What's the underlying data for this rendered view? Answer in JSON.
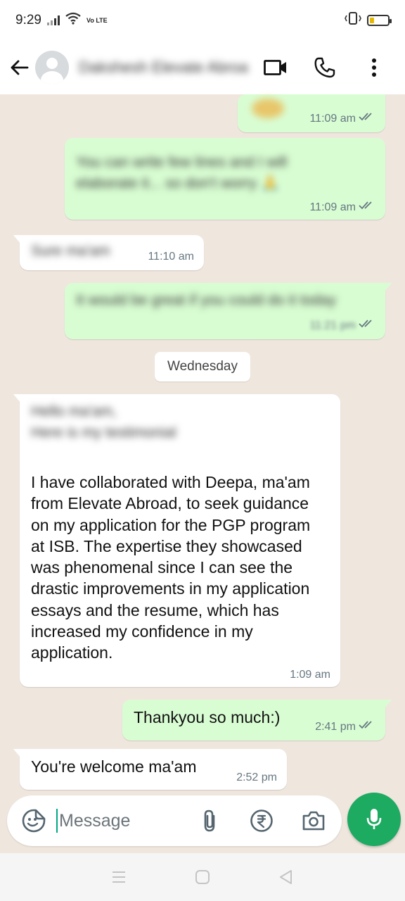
{
  "status_bar": {
    "time": "9:29",
    "network_label": "Vo LTE"
  },
  "header": {
    "contact_name": "Dakshesh Elevate Abroad",
    "icons": [
      "back-arrow-icon",
      "avatar",
      "video-call-icon",
      "voice-call-icon",
      "more-options-icon"
    ]
  },
  "messages": [
    {
      "direction": "outgoing",
      "text": "",
      "time": "11:09 am",
      "read": true,
      "blurred": true
    },
    {
      "direction": "outgoing",
      "text": "You can write few lines and I will elaborate it... so don't worry 🙏",
      "time": "11:09 am",
      "read": true,
      "blurred": true
    },
    {
      "direction": "incoming",
      "text": "Sure ma'am",
      "time": "11:10 am",
      "blurred": true
    },
    {
      "direction": "outgoing",
      "text": "It would be great if you could do it today",
      "time": "11:21 pm",
      "read": true,
      "blurred": true
    },
    {
      "direction": "incoming",
      "intro": "Hello ma'am,\nHere is my testimonial",
      "text": "I have collaborated with Deepa, ma'am from Elevate Abroad, to seek guidance on my application for the PGP program at ISB. The expertise they showcased was phenomenal since I can see the drastic improvements in my application essays and the resume, which has increased my confidence in my application.",
      "time": "1:09 am"
    },
    {
      "direction": "outgoing",
      "text": "Thankyou so much:)",
      "time": "2:41 pm",
      "read": true
    },
    {
      "direction": "incoming",
      "text": "You're welcome ma'am",
      "time": "2:52 pm"
    }
  ],
  "date_divider": "Wednesday",
  "composer": {
    "placeholder": "Message"
  },
  "colors": {
    "outgoing_bubble": "#d9fdd3",
    "incoming_bubble": "#ffffff",
    "chat_background": "#efe7de",
    "accent_green": "#1daa61",
    "read_ticks": "#667781"
  }
}
